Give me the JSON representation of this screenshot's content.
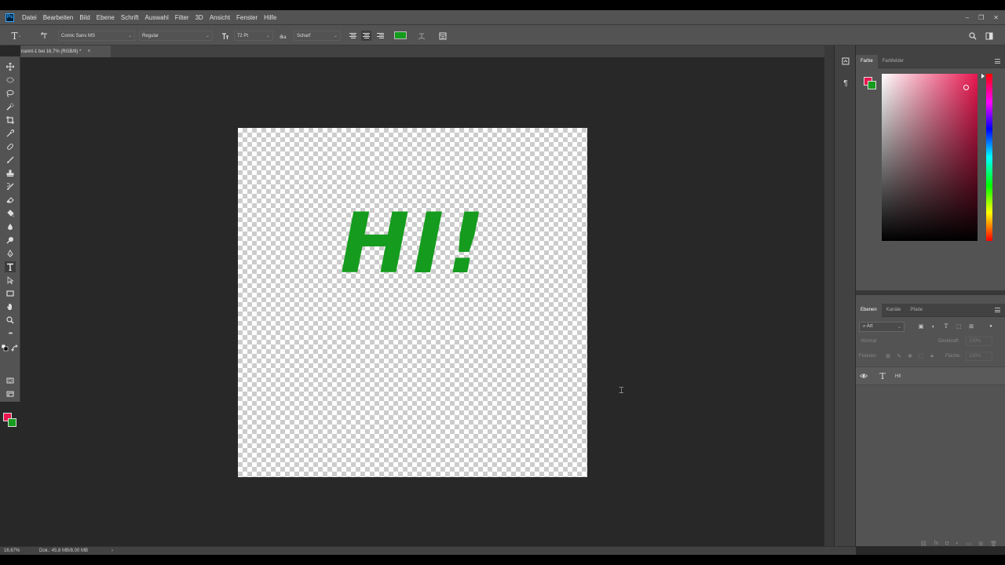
{
  "app": {
    "logo": "Ps"
  },
  "menu": {
    "items": [
      "Datei",
      "Bearbeiten",
      "Bild",
      "Ebene",
      "Schrift",
      "Auswahl",
      "Filter",
      "3D",
      "Ansicht",
      "Fenster",
      "Hilfe"
    ]
  },
  "window_controls": {
    "minimize": "–",
    "restore": "❐",
    "close": "✕"
  },
  "options": {
    "tool_glyph": "T",
    "font_family": "Comic Sans MS",
    "font_style": "Regular",
    "font_size": "72 Pt",
    "antialias": "Scharf",
    "text_color": "#159c1e"
  },
  "document": {
    "tab_title": "nannt-1 bei 16,7% (RGB/8) *",
    "tab_close": "×",
    "text": "HI!",
    "text_color": "#159c1e"
  },
  "toolbar": {
    "foreground_color": "#e8174f",
    "background_color": "#159c1e",
    "more_label": "•••"
  },
  "color_panel": {
    "tabs": [
      "Farbe",
      "Farbfelder"
    ],
    "foreground_color": "#e8174f",
    "background_color": "#159c1e"
  },
  "layers_panel": {
    "tabs": [
      "Ebenen",
      "Kanäle",
      "Pfade"
    ],
    "filter_label": "Art",
    "blend_mode": "Normal",
    "opacity_label": "Deckkraft:",
    "opacity_value": "100%",
    "lock_label": "Fixieren:",
    "fill_label": "Fläche:",
    "fill_value": "100%",
    "layers": [
      {
        "name": "HI!",
        "type_glyph": "T"
      }
    ]
  },
  "status": {
    "zoom": "16,67%",
    "doc_info": "Dok.: 45,8 MB/8,00 MB",
    "arrow": "›"
  }
}
